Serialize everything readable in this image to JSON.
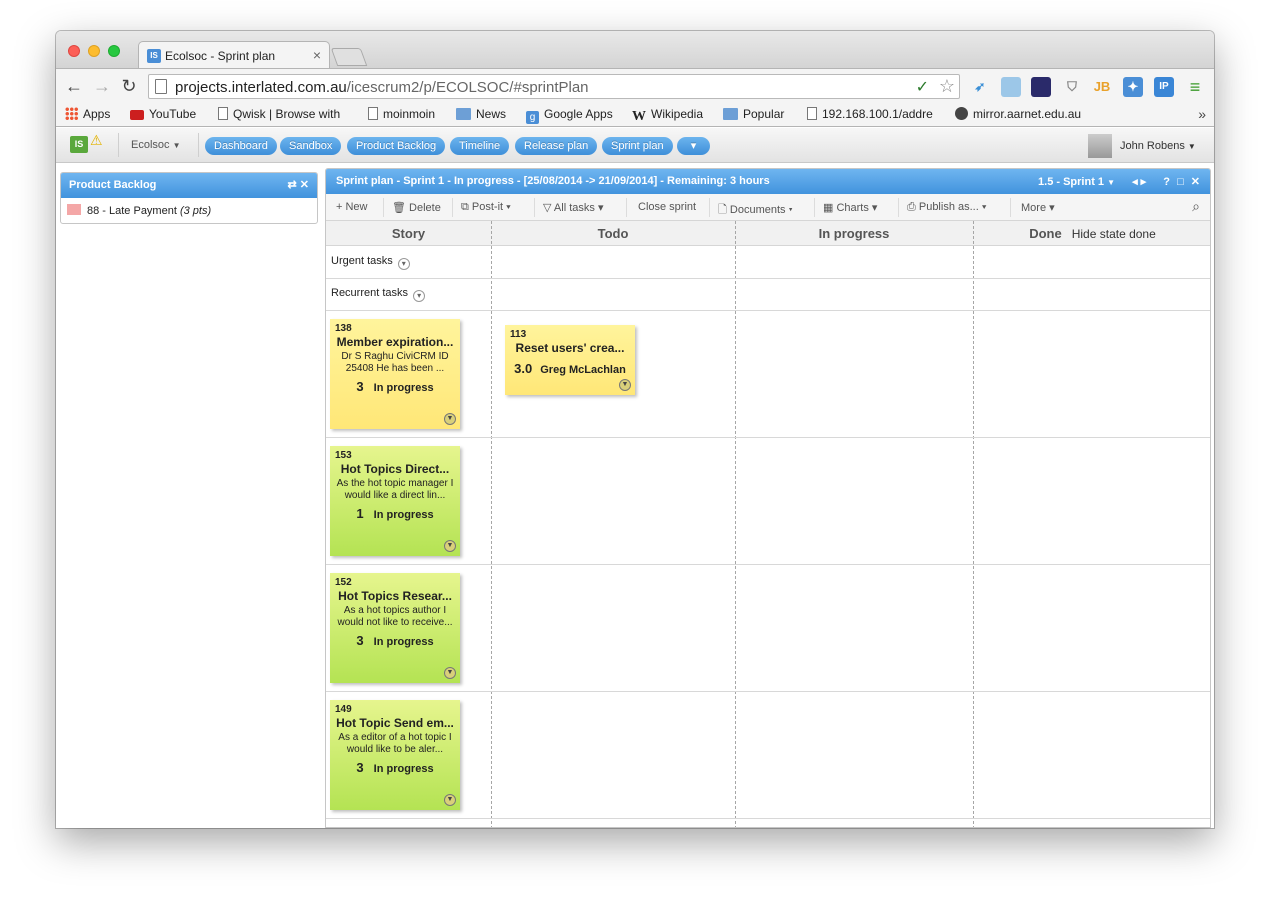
{
  "browser": {
    "tab_title": "Ecolsoc - Sprint plan",
    "tab_favicon": "IS",
    "url_host": "projects.interlated.com.au",
    "url_path": "/icescrum2/p/ECOLSOC/#sprintPlan",
    "bookmarks": [
      {
        "label": "Apps",
        "icon": "apps-icon"
      },
      {
        "label": "YouTube",
        "icon": "youtube-icon"
      },
      {
        "label": "Qwisk | Browse with",
        "icon": "page-icon"
      },
      {
        "label": "moinmoin",
        "icon": "page-icon"
      },
      {
        "label": "News",
        "icon": "folder-icon"
      },
      {
        "label": "Google Apps",
        "icon": "google-icon"
      },
      {
        "label": "Wikipedia",
        "icon": "wikipedia-icon"
      },
      {
        "label": "Popular",
        "icon": "folder-icon"
      },
      {
        "label": "192.168.100.1/addre",
        "icon": "page-icon"
      },
      {
        "label": "mirror.aarnet.edu.au",
        "icon": "mirror-icon"
      }
    ]
  },
  "app": {
    "logo": "IS",
    "project": "Ecolsoc",
    "nav": [
      "Dashboard",
      "Sandbox",
      "Product Backlog",
      "Timeline",
      "Release plan",
      "Sprint plan",
      "▾"
    ],
    "user": "John Robens"
  },
  "backlog_panel": {
    "title": "Product Backlog",
    "item_text": "88 - Late Payment",
    "item_pts": "(3 pts)"
  },
  "sprint": {
    "title": "Sprint plan - Sprint 1 - In progress - [25/08/2014 -> 21/09/2014] - Remaining: 3 hours",
    "selector": "1.5 - Sprint 1",
    "actions": [
      "+ New",
      "Delete",
      "Post-it",
      "All tasks",
      "Close sprint",
      "Documents",
      "Charts",
      "Publish as...",
      "More"
    ],
    "columns": {
      "story": "Story",
      "todo": "Todo",
      "inprogress": "In progress",
      "done": "Done",
      "hide_done": "Hide state done"
    },
    "lanes": {
      "urgent": "Urgent tasks",
      "recurrent": "Recurrent tasks"
    },
    "stories": [
      {
        "id": "138",
        "title": "Member expiration...",
        "desc": "Dr S Raghu CiviCRM ID 25408 He has been ...",
        "points": "3",
        "state": "In progress",
        "color": "#ffe777"
      },
      {
        "id": "153",
        "title": "Hot Topics Direct...",
        "desc": "As the hot topic manager I would like a direct lin...",
        "points": "1",
        "state": "In progress",
        "color": "#b4e353"
      },
      {
        "id": "152",
        "title": "Hot Topics Resear...",
        "desc": "As a hot topics author I would not like to receive...",
        "points": "3",
        "state": "In progress",
        "color": "#b4e353"
      },
      {
        "id": "149",
        "title": "Hot Topic Send em...",
        "desc": "As a editor of a hot topic I would like to be aler...",
        "points": "3",
        "state": "In progress",
        "color": "#b4e353"
      }
    ],
    "task": {
      "id": "113",
      "title": "Reset users' crea...",
      "estimate": "3.0",
      "owner": "Greg McLachlan"
    }
  }
}
